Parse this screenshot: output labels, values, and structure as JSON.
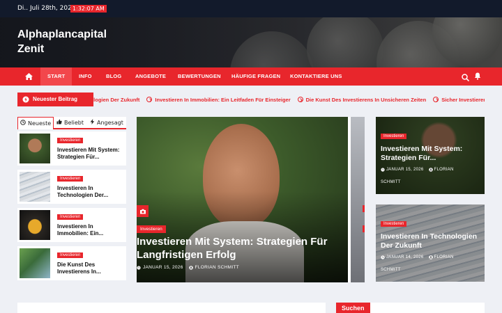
{
  "topbar": {
    "date": "Di.. Juli 28th, 2026",
    "time": "1:32:07 AM"
  },
  "site": {
    "title_line1": "Alphaplancapital",
    "title_line2": "Zenit"
  },
  "nav": {
    "home_icon": "home-icon",
    "items": [
      "Start",
      "Info",
      "Blog",
      "Angebote",
      "Bewertungen",
      "Häufige Fragen",
      "Kontaktiere Uns"
    ],
    "search_icon": "search-icon",
    "bell_icon": "bell-icon"
  },
  "ticker": {
    "label": "Neuester Beitrag",
    "items": [
      "nologien Der Zukunft",
      "Investieren In Immobilien: Ein Leitfaden Für Einsteiger",
      "Die Kunst Des Investierens In Unsicheren Zeiten",
      "Sicher Investieren: Ri"
    ]
  },
  "sidebar": {
    "tabs": [
      "Neueste",
      "Beliebt",
      "Angesagt"
    ],
    "posts": [
      {
        "category": "Investieren",
        "title": "Investieren Mit System: Strategien Für..."
      },
      {
        "category": "Investieren",
        "title": "Investieren In Technologien Der..."
      },
      {
        "category": "Investieren",
        "title": "Investieren In Immobilien: Ein..."
      },
      {
        "category": "Investieren",
        "title": "Die Kunst Des Investierens In..."
      }
    ]
  },
  "featured": {
    "category": "Investieren",
    "title": "Investieren Mit System: Strategien Für Langfristigen Erfolg",
    "date": "JANUAR 15, 2026",
    "author": "FLORIAN SCHMITT"
  },
  "cards": [
    {
      "category": "Investieren",
      "title": "Investieren Mit System: Strategien Für...",
      "date": "JANUAR 15, 2026",
      "author_first": "FLORIAN",
      "author_last": "SCHMITT"
    },
    {
      "category": "Investieren",
      "title": "Investieren In Technologien Der Zukunft",
      "date": "JANUAR 14, 2026",
      "author_first": "FLORIAN",
      "author_last": "SCHMITT"
    }
  ],
  "search": {
    "label": "Suchen"
  },
  "colors": {
    "accent": "#e8262c",
    "dark": "#121a2b"
  }
}
